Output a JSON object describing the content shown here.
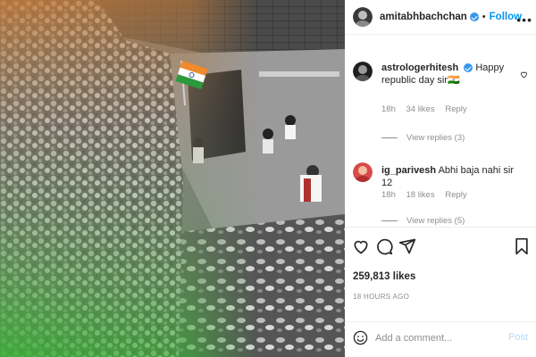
{
  "post": {
    "image_alt": ""
  },
  "header": {
    "username": "amitabhbachchan",
    "verified": true,
    "separator": "•",
    "follow_label": "Follow",
    "more_icon": "more-horizontal-icon"
  },
  "comments": [
    {
      "username": "astrologerhitesh",
      "verified": true,
      "text": "Happy republic day sir🇮🇳",
      "time": "18h",
      "likes": "34 likes",
      "reply_label": "Reply",
      "view_replies": "View replies (3)"
    },
    {
      "username": "ig_parivesh",
      "verified": false,
      "text": "Abhi baja nahi sir 12",
      "time": "18h",
      "likes": "18 likes",
      "reply_label": "Reply",
      "view_replies": "View replies (5)"
    }
  ],
  "actions": {
    "like_icon": "heart-icon",
    "comment_icon": "comment-icon",
    "share_icon": "share-icon",
    "save_icon": "bookmark-icon"
  },
  "likes_count": "259,813 likes",
  "posted_ago": "18 HOURS AGO",
  "add_comment": {
    "emoji_icon": "emoji-icon",
    "placeholder": "Add a comment...",
    "post_label": "Post"
  },
  "colors": {
    "accent": "#0095f6",
    "muted": "#8e8e8e",
    "post_disabled": "#b3dbff",
    "verified": "#3897f0"
  }
}
